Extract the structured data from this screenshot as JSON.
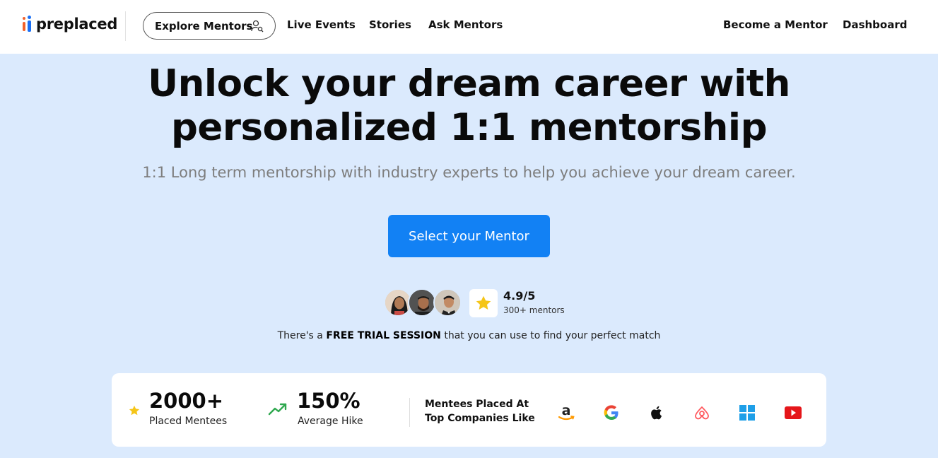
{
  "brand": {
    "name": "preplaced"
  },
  "nav": {
    "explore": "Explore Mentors",
    "links": [
      "Live Events",
      "Stories",
      "Ask Mentors"
    ],
    "right": [
      "Become a Mentor",
      "Dashboard"
    ]
  },
  "hero": {
    "title_line1": "Unlock your dream career with",
    "title_line2": "personalized 1:1 mentorship",
    "subtitle": "1:1 Long term mentorship with industry experts to help you achieve your dream career.",
    "cta": "Select your Mentor"
  },
  "rating": {
    "score": "4.9/5",
    "mentors": "300+ mentors"
  },
  "trial": {
    "prefix": "There's a ",
    "highlight": "FREE TRIAL SESSION",
    "suffix": " that you can use to find your perfect match"
  },
  "stats": {
    "placed": {
      "value": "2000+",
      "label": "Placed Mentees"
    },
    "hike": {
      "value": "150%",
      "label": "Average Hike"
    },
    "companies_label": "Mentees Placed At Top Companies Like",
    "companies": [
      "amazon-icon",
      "google-icon",
      "apple-icon",
      "airbnb-icon",
      "windows-icon",
      "youtube-icon"
    ]
  },
  "colors": {
    "primary": "#1281f4",
    "hero_bg": "#dbeafd",
    "star": "#f5c518",
    "trend": "#2fa84f"
  }
}
